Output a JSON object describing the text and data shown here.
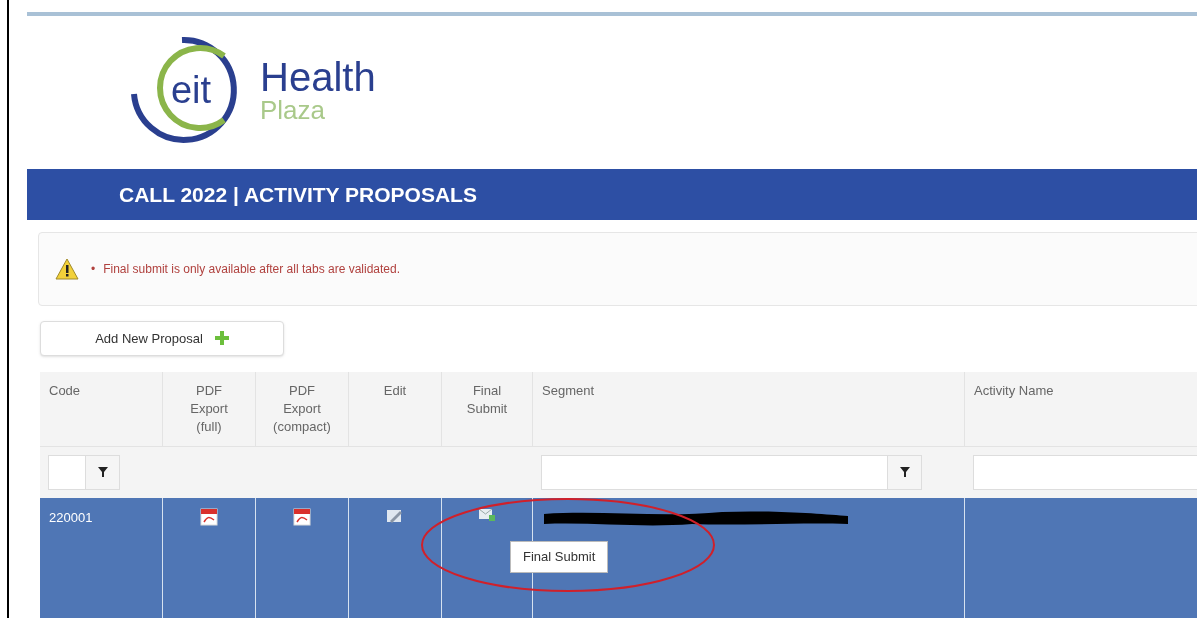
{
  "logo": {
    "mark": "eit",
    "name": "Health",
    "subname": "Plaza"
  },
  "banner": {
    "title": "CALL 2022 | ACTIVITY PROPOSALS"
  },
  "alert": {
    "bullet": "•",
    "message": "Final submit is only available after all tabs are validated."
  },
  "add_button": {
    "label": "Add New Proposal"
  },
  "table": {
    "columns": [
      {
        "label": "Code",
        "kind": "filterable"
      },
      {
        "label": "PDF Export (full)",
        "kind": "action"
      },
      {
        "label": "PDF Export (compact)",
        "kind": "action"
      },
      {
        "label": "Edit",
        "kind": "action"
      },
      {
        "label": "Final Submit",
        "kind": "action"
      },
      {
        "label": "Segment",
        "kind": "filterable"
      },
      {
        "label": "Activity Name",
        "kind": "searchable"
      }
    ],
    "rows": [
      {
        "selected": true,
        "cells": [
          {
            "kind": "text",
            "text": "220001"
          },
          {
            "kind": "pdf"
          },
          {
            "kind": "pdf"
          },
          {
            "kind": "edit"
          },
          {
            "kind": "submit"
          },
          {
            "kind": "redacted"
          },
          {
            "kind": "empty"
          }
        ]
      }
    ]
  },
  "tooltip": {
    "text": "Final Submit"
  },
  "annotation": {
    "kind": "ellipse"
  }
}
